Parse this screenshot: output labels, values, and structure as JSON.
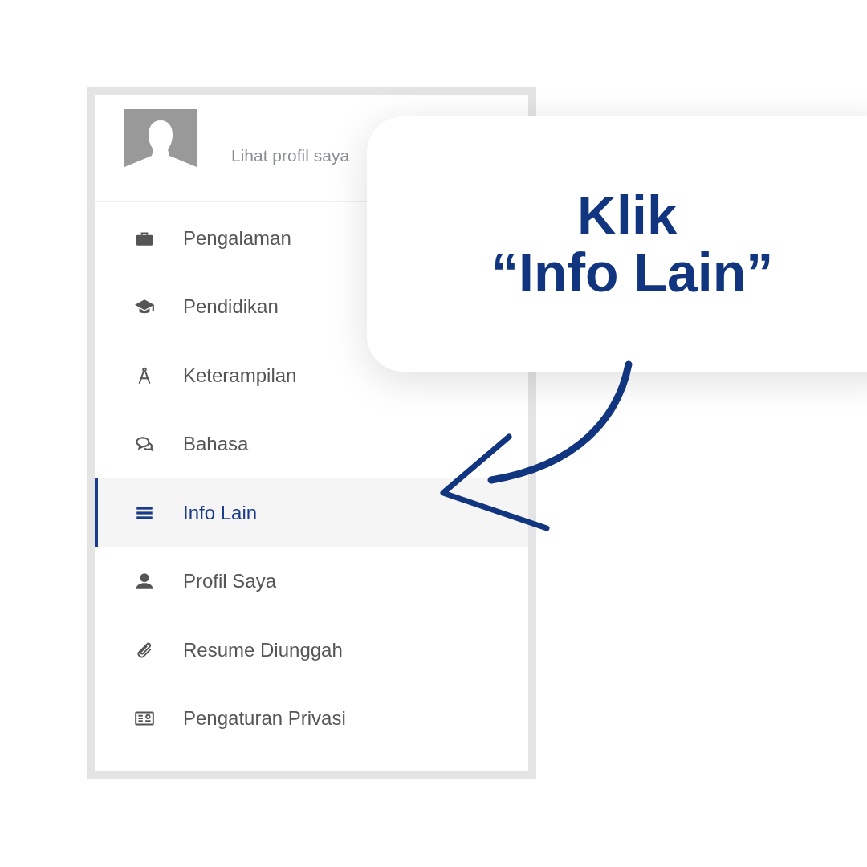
{
  "profile_header": {
    "link": "Lihat profil saya"
  },
  "menu": [
    {
      "label": "Pengalaman",
      "selected": false
    },
    {
      "label": "Pendidikan",
      "selected": false
    },
    {
      "label": "Keterampilan",
      "selected": false
    },
    {
      "label": "Bahasa",
      "selected": false
    },
    {
      "label": "Info Lain",
      "selected": true
    },
    {
      "label": "Profil Saya",
      "selected": false
    },
    {
      "label": "Resume Diunggah",
      "selected": false
    },
    {
      "label": "Pengaturan Privasi",
      "selected": false
    }
  ],
  "callout": {
    "lines": [
      "Klik",
      "“Info Lain”"
    ]
  }
}
